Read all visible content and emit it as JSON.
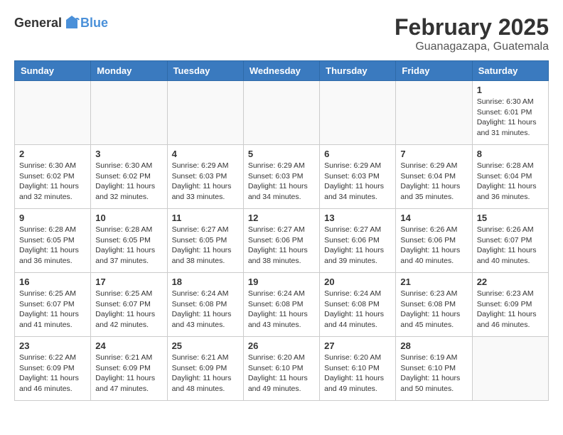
{
  "header": {
    "logo_general": "General",
    "logo_blue": "Blue",
    "month_title": "February 2025",
    "location": "Guanagazapa, Guatemala"
  },
  "days_of_week": [
    "Sunday",
    "Monday",
    "Tuesday",
    "Wednesday",
    "Thursday",
    "Friday",
    "Saturday"
  ],
  "weeks": [
    [
      {
        "day": "",
        "info": ""
      },
      {
        "day": "",
        "info": ""
      },
      {
        "day": "",
        "info": ""
      },
      {
        "day": "",
        "info": ""
      },
      {
        "day": "",
        "info": ""
      },
      {
        "day": "",
        "info": ""
      },
      {
        "day": "1",
        "info": "Sunrise: 6:30 AM\nSunset: 6:01 PM\nDaylight: 11 hours and 31 minutes."
      }
    ],
    [
      {
        "day": "2",
        "info": "Sunrise: 6:30 AM\nSunset: 6:02 PM\nDaylight: 11 hours and 32 minutes."
      },
      {
        "day": "3",
        "info": "Sunrise: 6:30 AM\nSunset: 6:02 PM\nDaylight: 11 hours and 32 minutes."
      },
      {
        "day": "4",
        "info": "Sunrise: 6:29 AM\nSunset: 6:03 PM\nDaylight: 11 hours and 33 minutes."
      },
      {
        "day": "5",
        "info": "Sunrise: 6:29 AM\nSunset: 6:03 PM\nDaylight: 11 hours and 34 minutes."
      },
      {
        "day": "6",
        "info": "Sunrise: 6:29 AM\nSunset: 6:03 PM\nDaylight: 11 hours and 34 minutes."
      },
      {
        "day": "7",
        "info": "Sunrise: 6:29 AM\nSunset: 6:04 PM\nDaylight: 11 hours and 35 minutes."
      },
      {
        "day": "8",
        "info": "Sunrise: 6:28 AM\nSunset: 6:04 PM\nDaylight: 11 hours and 36 minutes."
      }
    ],
    [
      {
        "day": "9",
        "info": "Sunrise: 6:28 AM\nSunset: 6:05 PM\nDaylight: 11 hours and 36 minutes."
      },
      {
        "day": "10",
        "info": "Sunrise: 6:28 AM\nSunset: 6:05 PM\nDaylight: 11 hours and 37 minutes."
      },
      {
        "day": "11",
        "info": "Sunrise: 6:27 AM\nSunset: 6:05 PM\nDaylight: 11 hours and 38 minutes."
      },
      {
        "day": "12",
        "info": "Sunrise: 6:27 AM\nSunset: 6:06 PM\nDaylight: 11 hours and 38 minutes."
      },
      {
        "day": "13",
        "info": "Sunrise: 6:27 AM\nSunset: 6:06 PM\nDaylight: 11 hours and 39 minutes."
      },
      {
        "day": "14",
        "info": "Sunrise: 6:26 AM\nSunset: 6:06 PM\nDaylight: 11 hours and 40 minutes."
      },
      {
        "day": "15",
        "info": "Sunrise: 6:26 AM\nSunset: 6:07 PM\nDaylight: 11 hours and 40 minutes."
      }
    ],
    [
      {
        "day": "16",
        "info": "Sunrise: 6:25 AM\nSunset: 6:07 PM\nDaylight: 11 hours and 41 minutes."
      },
      {
        "day": "17",
        "info": "Sunrise: 6:25 AM\nSunset: 6:07 PM\nDaylight: 11 hours and 42 minutes."
      },
      {
        "day": "18",
        "info": "Sunrise: 6:24 AM\nSunset: 6:08 PM\nDaylight: 11 hours and 43 minutes."
      },
      {
        "day": "19",
        "info": "Sunrise: 6:24 AM\nSunset: 6:08 PM\nDaylight: 11 hours and 43 minutes."
      },
      {
        "day": "20",
        "info": "Sunrise: 6:24 AM\nSunset: 6:08 PM\nDaylight: 11 hours and 44 minutes."
      },
      {
        "day": "21",
        "info": "Sunrise: 6:23 AM\nSunset: 6:08 PM\nDaylight: 11 hours and 45 minutes."
      },
      {
        "day": "22",
        "info": "Sunrise: 6:23 AM\nSunset: 6:09 PM\nDaylight: 11 hours and 46 minutes."
      }
    ],
    [
      {
        "day": "23",
        "info": "Sunrise: 6:22 AM\nSunset: 6:09 PM\nDaylight: 11 hours and 46 minutes."
      },
      {
        "day": "24",
        "info": "Sunrise: 6:21 AM\nSunset: 6:09 PM\nDaylight: 11 hours and 47 minutes."
      },
      {
        "day": "25",
        "info": "Sunrise: 6:21 AM\nSunset: 6:09 PM\nDaylight: 11 hours and 48 minutes."
      },
      {
        "day": "26",
        "info": "Sunrise: 6:20 AM\nSunset: 6:10 PM\nDaylight: 11 hours and 49 minutes."
      },
      {
        "day": "27",
        "info": "Sunrise: 6:20 AM\nSunset: 6:10 PM\nDaylight: 11 hours and 49 minutes."
      },
      {
        "day": "28",
        "info": "Sunrise: 6:19 AM\nSunset: 6:10 PM\nDaylight: 11 hours and 50 minutes."
      },
      {
        "day": "",
        "info": ""
      }
    ]
  ]
}
